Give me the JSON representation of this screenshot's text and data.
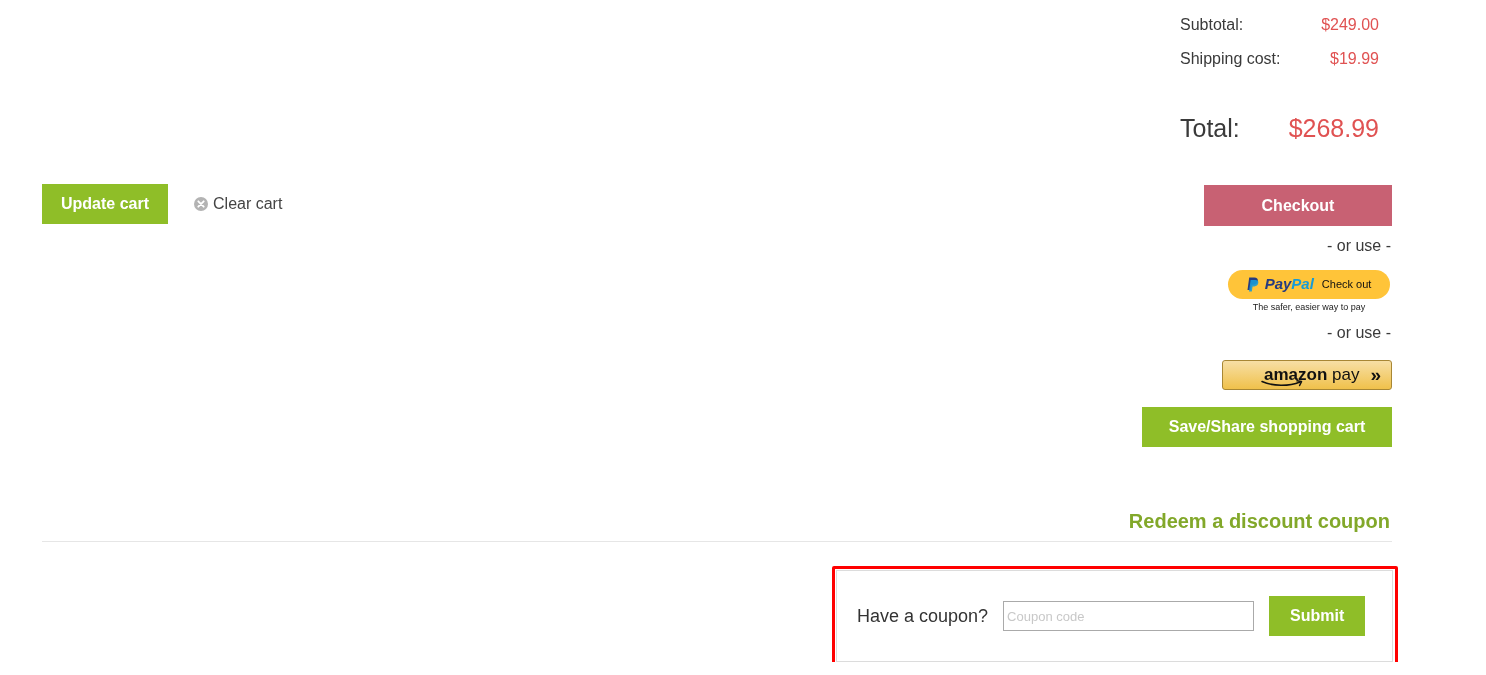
{
  "summary": {
    "rows": [
      {
        "label": "Subtotal:",
        "value": "$249.00"
      },
      {
        "label": "Shipping cost:",
        "value": "$19.99"
      }
    ],
    "total": {
      "label": "Total:",
      "value": "$268.99"
    }
  },
  "cart_actions": {
    "update_button": "Update cart",
    "clear_link": "Clear cart"
  },
  "payment_options": [
    {
      "kind": "checkout",
      "label": "Checkout"
    },
    {
      "kind": "separator",
      "label": "- or use -"
    },
    {
      "kind": "paypal",
      "brand_parts": [
        "Pay",
        "Pal"
      ],
      "label": "Check out",
      "tagline": "The safer, easier way to pay"
    },
    {
      "kind": "separator",
      "label": "- or use -"
    },
    {
      "kind": "amazon",
      "label": "**amazon** pay",
      "arrow": "»"
    },
    {
      "kind": "save",
      "label": "Save/Share shopping cart"
    }
  ],
  "coupon": {
    "heading": "Redeem a discount coupon",
    "prompt": "Have a coupon?",
    "field": {
      "placeholder": "Coupon code"
    },
    "submit": "Submit",
    "highlighted": true
  }
}
